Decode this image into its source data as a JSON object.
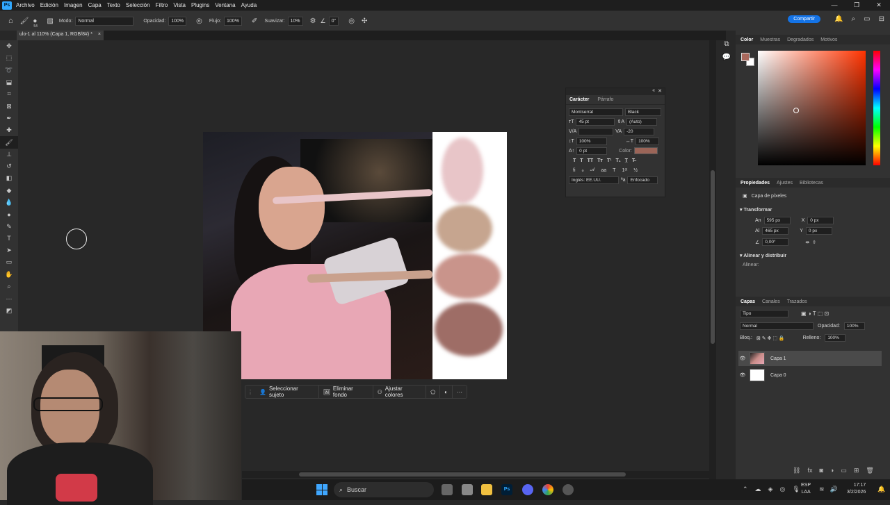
{
  "menu": {
    "items": [
      "Archivo",
      "Edición",
      "Imagen",
      "Capa",
      "Texto",
      "Selección",
      "Filtro",
      "Vista",
      "Plugins",
      "Ventana",
      "Ayuda"
    ]
  },
  "options": {
    "brush_size": "54",
    "mode_label": "Modo:",
    "mode": "Normal",
    "opacity_label": "Opacidad:",
    "opacity": "100%",
    "flow_label": "Flujo:",
    "flow": "100%",
    "smooth_label": "Suavizar:",
    "smooth": "10%",
    "angle": "0°",
    "share": "Compartir"
  },
  "document": {
    "tab_title": "ulo-1 al 110% (Capa 1, RGB/8#) *",
    "close": "×"
  },
  "contextbar": {
    "select_subject": "Seleccionar sujeto",
    "remove_bg": "Eliminar fondo",
    "adjust_colors": "Ajustar colores",
    "more": "···"
  },
  "character": {
    "tab1": "Carácter",
    "tab2": "Párrafo",
    "font": "Montserrat",
    "weight": "Black",
    "size": "45 pt",
    "leading": "(Auto)",
    "tracking": "-20",
    "vscale": "100%",
    "hscale": "100%",
    "baseline": "0 pt",
    "color_label": "Color:",
    "color": "#9b6558",
    "language": "Inglés: EE.UU.",
    "aa": "Enfocado"
  },
  "color_panel": {
    "tabs": [
      "Color",
      "Muestras",
      "Degradados",
      "Motivos"
    ],
    "foreground": "#a9685c",
    "background": "#ffffff"
  },
  "properties": {
    "tabs": [
      "Propiedades",
      "Ajustes",
      "Bibliotecas"
    ],
    "type": "Capa de píxeles",
    "transform_title": "Transformar",
    "w_label": "An",
    "w": "595 px",
    "x_label": "X",
    "x": "0 px",
    "h_label": "Al",
    "h": "465 px",
    "y_label": "Y",
    "y": "0 px",
    "angle": "0,00°",
    "align_title": "Alinear y distribuir",
    "align_label": "Alinear:"
  },
  "layers": {
    "tabs": [
      "Capas",
      "Canales",
      "Trazados"
    ],
    "filter": "Tipo",
    "blend": "Normal",
    "opacity_label": "Opacidad:",
    "opacity": "100%",
    "lock_label": "Bloq.:",
    "fill_label": "Relleno:",
    "fill": "100%",
    "items": [
      {
        "name": "Capa 1"
      },
      {
        "name": "Capa 0"
      }
    ]
  },
  "swatches": [
    "#e8c5c8",
    "#c6a58f",
    "#c9948b",
    "#9e6d66"
  ],
  "taskbar": {
    "search": "Buscar",
    "lang1": "ESP",
    "lang2": "LAA",
    "time": "17:17",
    "date": "3/2/2026"
  }
}
